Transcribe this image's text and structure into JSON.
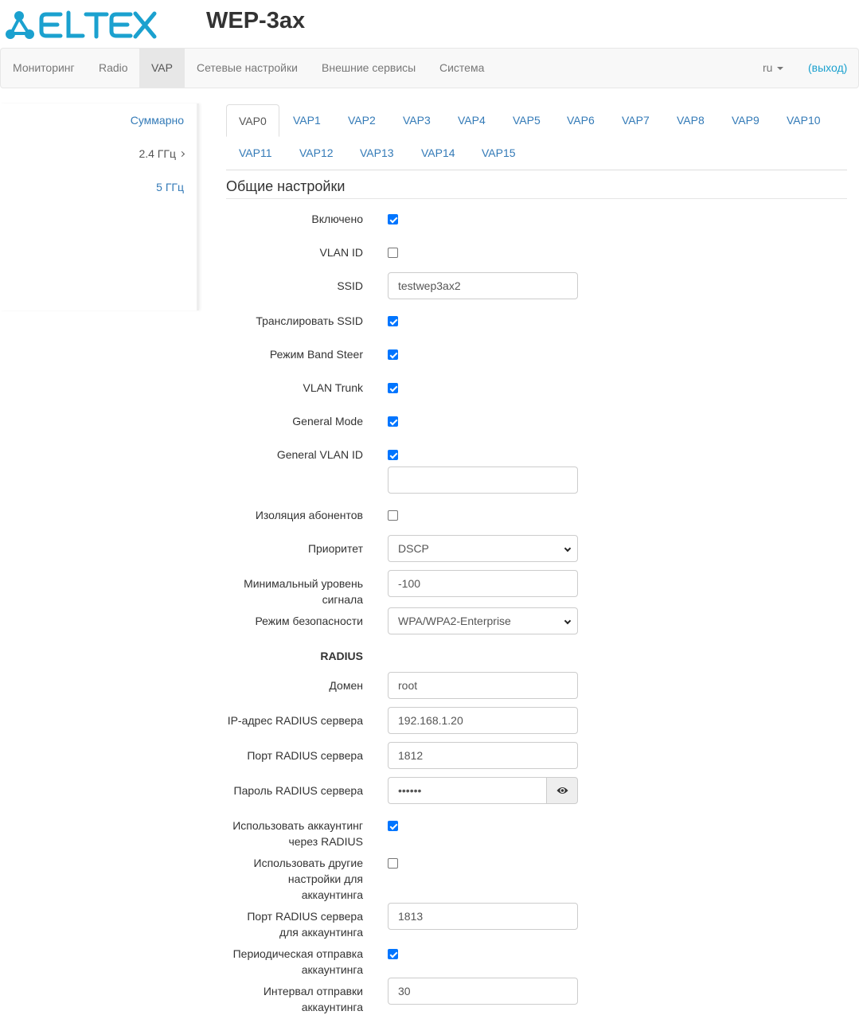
{
  "header": {
    "logo_text": "ELTEX",
    "logo_color": "#1ba1cf",
    "product": "WEP-3ax"
  },
  "nav": {
    "items": [
      {
        "label": "Мониторинг",
        "icon": ""
      },
      {
        "label": "Radio"
      },
      {
        "label": "VAP",
        "active": true
      },
      {
        "label": "Сетевые настройки"
      },
      {
        "label": "Внешние сервисы"
      },
      {
        "label": "Система"
      }
    ],
    "lang": "ru",
    "logout": "(выход)"
  },
  "sidebar": {
    "items": [
      {
        "label": "Суммарно"
      },
      {
        "label": "2.4 ГГц"
      },
      {
        "label": "5 ГГц"
      }
    ]
  },
  "tabs": [
    "VAP0",
    "VAP1",
    "VAP2",
    "VAP3",
    "VAP4",
    "VAP5",
    "VAP6",
    "VAP7",
    "VAP8",
    "VAP9",
    "VAP10",
    "VAP11",
    "VAP12",
    "VAP13",
    "VAP14",
    "VAP15"
  ],
  "section_title": "Общие настройки",
  "form": {
    "enabled": {
      "label": "Включено",
      "checked": true
    },
    "vlan_id": {
      "label": "VLAN ID",
      "checked": false
    },
    "ssid": {
      "label": "SSID",
      "value": "testwep3ax2"
    },
    "broadcast_ssid": {
      "label": "Транслировать SSID",
      "checked": true
    },
    "band_steer": {
      "label": "Режим Band Steer",
      "checked": true
    },
    "vlan_trunk": {
      "label": "VLAN Trunk",
      "checked": true
    },
    "general_mode": {
      "label": "General Mode",
      "checked": true
    },
    "general_vlan_id": {
      "label": "General VLAN ID",
      "checked": true,
      "value": ""
    },
    "client_isolation": {
      "label": "Изоляция абонентов",
      "checked": false
    },
    "priority": {
      "label": "Приоритет",
      "value": "DSCP"
    },
    "min_signal": {
      "label_line1": "Минимальный уровень",
      "label_line2": "сигнала",
      "value": "-100"
    },
    "security_mode": {
      "label": "Режим безопасности",
      "value": "WPA/WPA2-Enterprise"
    },
    "radius_header": "RADIUS",
    "domain": {
      "label": "Домен",
      "value": "root"
    },
    "radius_ip": {
      "label": "IP-адрес RADIUS сервера",
      "value": "192.168.1.20"
    },
    "radius_port": {
      "label": "Порт RADIUS сервера",
      "value": "1812"
    },
    "radius_password": {
      "label": "Пароль RADIUS сервера",
      "value": "••••••",
      "icon": "eye-icon"
    },
    "use_accounting": {
      "label_line1": "Использовать аккаунтинг",
      "label_line2": "через RADIUS",
      "checked": true
    },
    "other_accounting": {
      "label_line1": "Использовать другие",
      "label_line2": "настройки для",
      "label_line3": "аккаунтинга",
      "checked": false
    },
    "accounting_port": {
      "label_line1": "Порт RADIUS сервера",
      "label_line2": "для аккаунтинга",
      "value": "1813"
    },
    "periodic_accounting": {
      "label_line1": "Периодическая отправка",
      "label_line2": "аккаунтинга",
      "checked": true
    },
    "accounting_interval": {
      "label_line1": "Интервал отправки",
      "label_line2": "аккаунтинга",
      "value": "30"
    }
  }
}
